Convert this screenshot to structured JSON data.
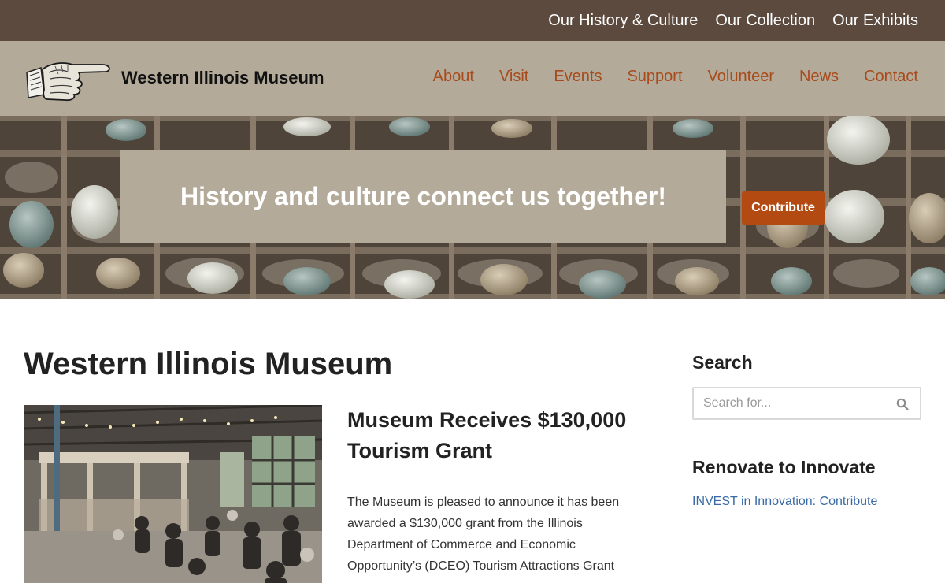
{
  "topbar": {
    "links": [
      {
        "label": "Our History & Culture"
      },
      {
        "label": "Our Collection"
      },
      {
        "label": "Our Exhibits"
      }
    ]
  },
  "header": {
    "logo_icon": "pointing-hand-icon",
    "site_title": "Western Illinois Museum",
    "nav": [
      {
        "label": "About"
      },
      {
        "label": "Visit"
      },
      {
        "label": "Events"
      },
      {
        "label": "Support"
      },
      {
        "label": "Volunteer"
      },
      {
        "label": "News"
      },
      {
        "label": "Contact"
      }
    ]
  },
  "hero": {
    "headline": "History and culture connect us together!",
    "button_label": "Contribute"
  },
  "main": {
    "page_title": "Western Illinois Museum",
    "post": {
      "title": "Museum Receives $130,000 Tourism Grant",
      "excerpt": "The Museum is pleased to announce it has been awarded a $130,000 grant from the Illinois Department of Commerce and Economic Opportunity’s (DCEO) Tourism Attractions Grant"
    }
  },
  "sidebar": {
    "search": {
      "heading": "Search",
      "placeholder": "Search for..."
    },
    "renovate": {
      "heading": "Renovate to Innovate",
      "link": "INVEST in Innovation: Contribute"
    }
  },
  "colors": {
    "topbar": "#5c4a3e",
    "header": "#b3aa99",
    "nav_link": "#a84a1a",
    "button": "#b24a12",
    "sidebar_link": "#3a6aa6"
  }
}
